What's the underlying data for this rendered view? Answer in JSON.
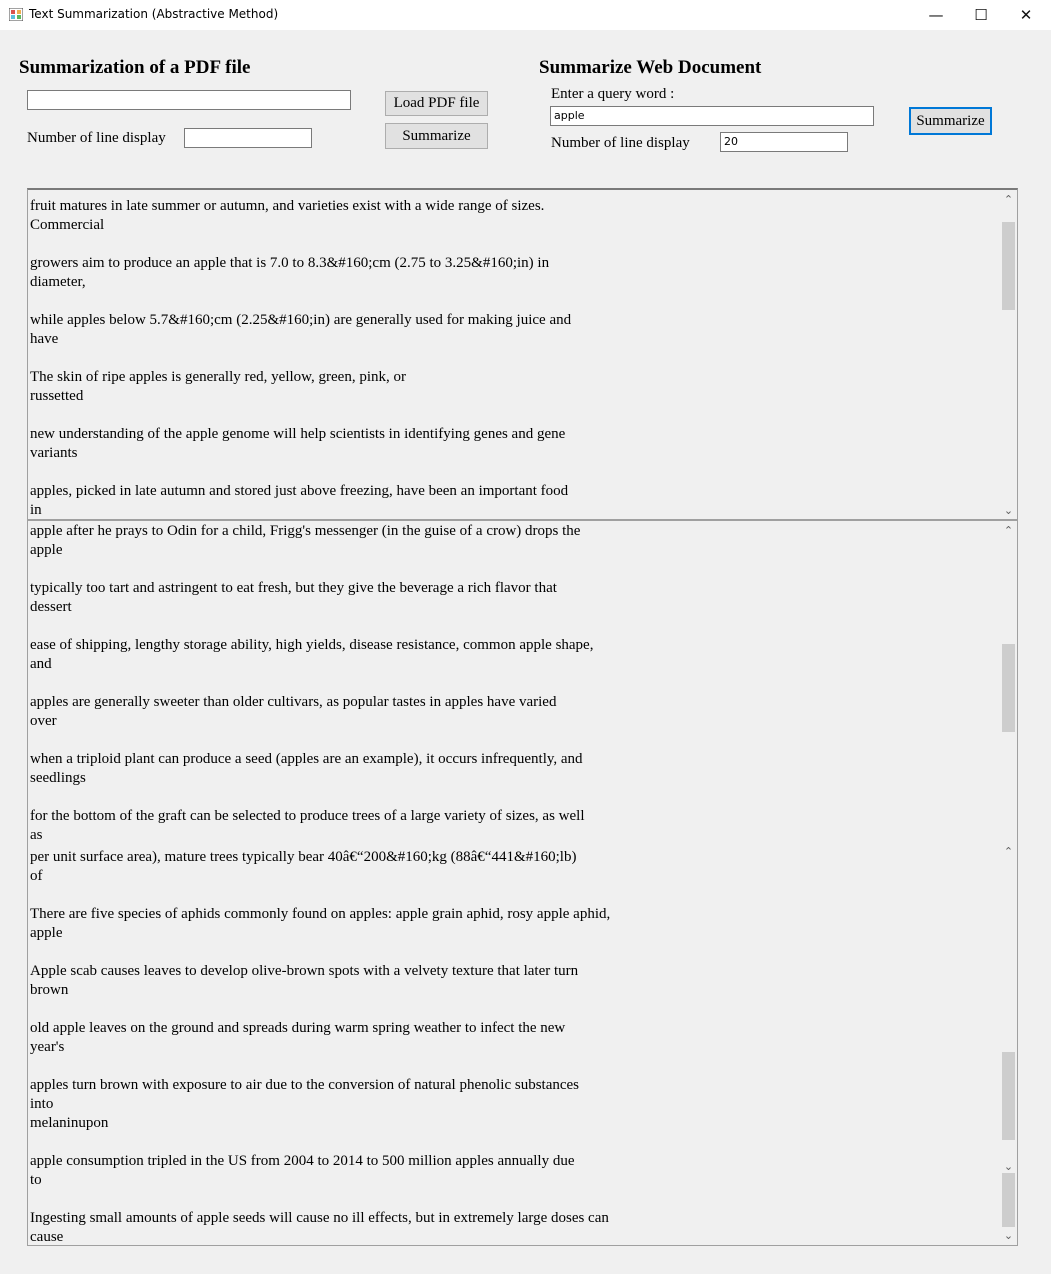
{
  "window": {
    "title": "Text Summarization (Abstractive Method)",
    "minimize": "—",
    "maximize": "☐",
    "close": "✕"
  },
  "pdf": {
    "heading": "Summarization of a PDF file",
    "path_value": "",
    "load_button": "Load PDF file",
    "lines_label": "Number of line display",
    "lines_value": "",
    "summarize_button": "Summarize"
  },
  "web": {
    "heading": "Summarize Web Document",
    "query_label": "Enter a query word :",
    "query_value": "apple",
    "lines_label": "Number of line display",
    "lines_value": "20",
    "summarize_button": "Summarize"
  },
  "upper_output": [
    {
      "l1": "fruit matures in late summer or autumn, and varieties exist with a wide range of sizes.",
      "l2": "Commercial"
    },
    {
      "l1": "growers aim to produce an apple that is 7.0 to 8.3&#160;cm (2.75 to 3.25&#160;in) in",
      "l2": "diameter,"
    },
    {
      "l1": "while apples below 5.7&#160;cm (2.25&#160;in) are generally used for making juice and",
      "l2": "have"
    },
    {
      "l1": "The skin of ripe apples is generally red, yellow, green, pink, or",
      "l2": "russetted"
    },
    {
      "l1": "new understanding of the apple genome will help scientists in identifying genes and gene",
      "l2": "variants"
    },
    {
      "l1": "apples, picked in late autumn and stored just above freezing, have been an important food",
      "l2": "in"
    }
  ],
  "lower_output": [
    {
      "l1": "apple after he prays to Odin for a child, Frigg's messenger (in the guise of a crow) drops the",
      "l2": "apple"
    },
    {
      "l1": "typically too tart and astringent to eat fresh, but they give the beverage a rich flavor that",
      "l2": "dessert"
    },
    {
      "l1": "ease of shipping, lengthy storage ability, high yields, disease resistance, common apple shape,",
      "l2": "and"
    },
    {
      "l1": "apples are generally sweeter than older cultivars, as popular tastes in apples have varied",
      "l2": "over"
    },
    {
      "l1": "when a triploid plant can produce a seed (apples are an example), it occurs infrequently, and",
      "l2": "seedlings"
    },
    {
      "l1": "for the bottom of the graft can be selected to produce trees of a large variety of sizes, as well",
      "l2": "as"
    },
    {
      "l1": "per unit surface area), mature trees typically bear 40â€“200&#160;kg (88â€“441&#160;lb)",
      "l2": "of"
    },
    {
      "l1": "There are five species of aphids commonly found on apples: apple grain aphid, rosy apple aphid,",
      "l2": "apple"
    },
    {
      "l1": "Apple scab causes leaves to develop olive-brown spots with a velvety texture that later turn",
      "l2": "brown"
    },
    {
      "l1": "old apple leaves on the ground and spreads during warm spring weather to infect the new",
      "l2": "year's"
    },
    {
      "l1": "apples turn brown with exposure to air due to the conversion of natural phenolic substances",
      "l2": "into",
      "l3": "melaninupon"
    },
    {
      "l1": "apple consumption tripled in the US from 2004 to 2014 to 500 million apples annually due",
      "l2": "to"
    },
    {
      "l1": "Ingesting small amounts of apple seeds will cause no ill effects, but in extremely large doses can",
      "l2": "cause"
    }
  ]
}
